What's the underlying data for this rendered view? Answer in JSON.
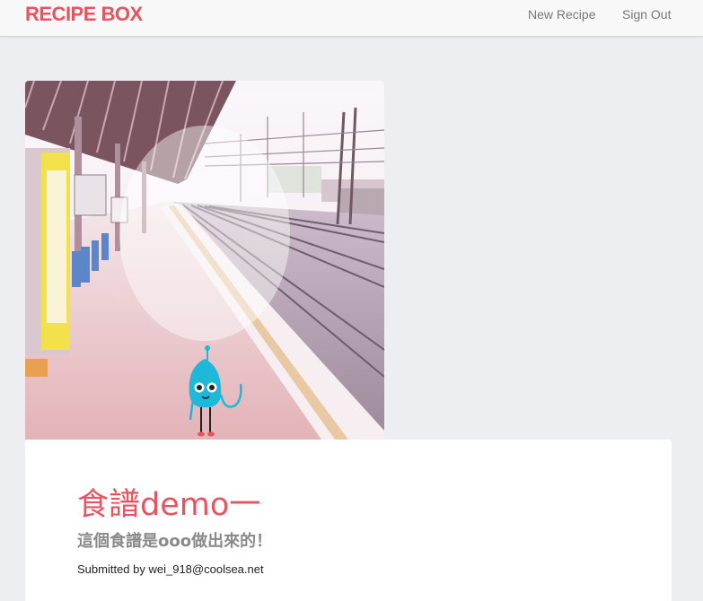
{
  "navbar": {
    "brand": "RECIPE BOX",
    "links": [
      {
        "label": "New Recipe"
      },
      {
        "label": "Sign Out"
      }
    ]
  },
  "recipe": {
    "image_alt": "train-platform-photo",
    "title": "食譜demo一",
    "description": "這個食譜是ooo做出來的！",
    "submitted_by": "Submitted by wei_918@coolsea.net"
  },
  "colors": {
    "brand": "#e8535d",
    "page_background": "#eceef2",
    "navbar_background": "#f8f8f8",
    "mascot": "#1eb8d9"
  }
}
